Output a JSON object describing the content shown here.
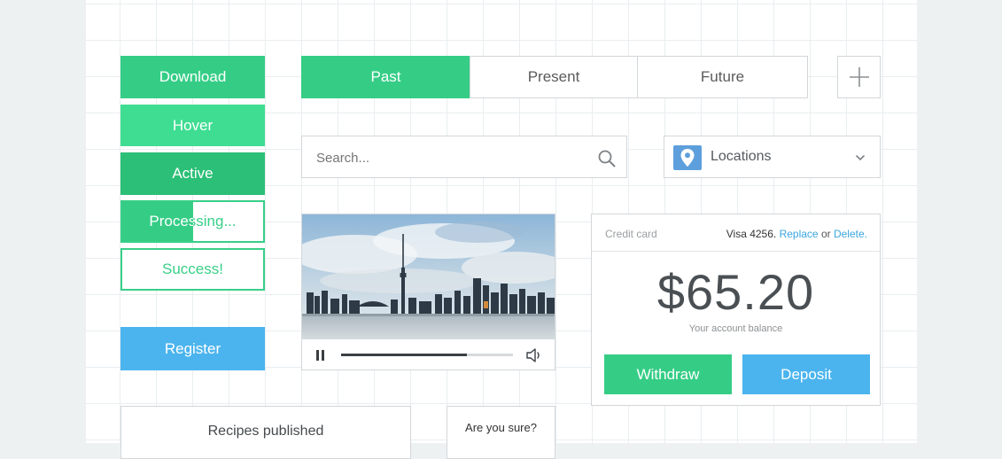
{
  "buttons": {
    "download": "Download",
    "hover": "Hover",
    "active": "Active",
    "processing": "Processing...",
    "processing_progress": 0.5,
    "success": "Success!",
    "register": "Register"
  },
  "segmented": {
    "items": [
      "Past",
      "Present",
      "Future"
    ],
    "selected": "Past"
  },
  "add_button_icon": "plus-icon",
  "search": {
    "placeholder": "Search...",
    "icon": "search-icon"
  },
  "locations": {
    "label": "Locations",
    "icon": "location-pin-icon",
    "chevron": "chevron-down-icon"
  },
  "video": {
    "progress": 0.73,
    "pause_icon": "pause-icon",
    "volume_icon": "volume-icon"
  },
  "credit_card": {
    "label": "Credit card",
    "card_text": "Visa 4256.",
    "replace": "Replace",
    "or": "or",
    "delete": "Delete.",
    "amount": "$65.20",
    "balance_caption": "Your account balance",
    "withdraw": "Withdraw",
    "deposit": "Deposit"
  },
  "recipes": {
    "label": "Recipes published"
  },
  "confirm": {
    "question": "Are you sure?"
  },
  "colors": {
    "green": "#35cd86",
    "green_light": "#3fdd92",
    "green_dark": "#2cbf77",
    "blue": "#4bb4ee",
    "link": "#3aa6e0"
  }
}
